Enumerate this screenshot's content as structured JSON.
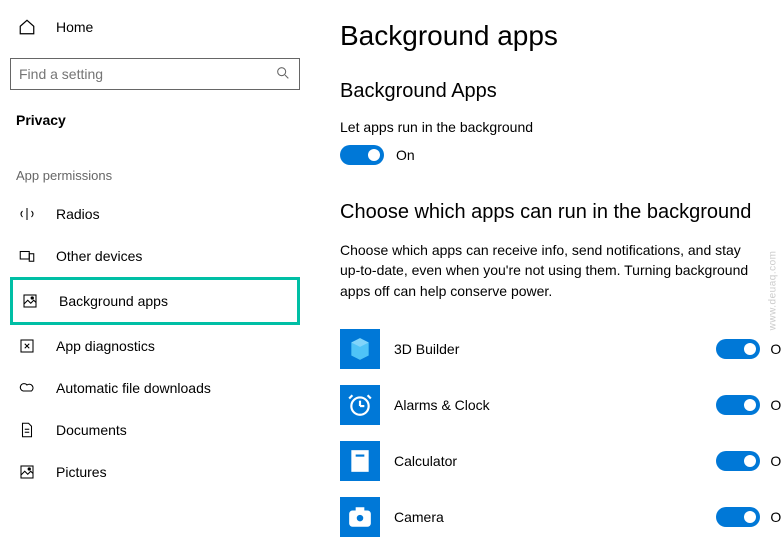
{
  "sidebar": {
    "home_label": "Home",
    "search_placeholder": "Find a setting",
    "section": "Privacy",
    "group": "App permissions",
    "items": [
      {
        "label": "Radios"
      },
      {
        "label": "Other devices"
      },
      {
        "label": "Background apps"
      },
      {
        "label": "App diagnostics"
      },
      {
        "label": "Automatic file downloads"
      },
      {
        "label": "Documents"
      },
      {
        "label": "Pictures"
      }
    ]
  },
  "main": {
    "title": "Background apps",
    "subheading1": "Background Apps",
    "master_label": "Let apps run in the background",
    "master_state": "On",
    "subheading2": "Choose which apps can run in the background",
    "description": "Choose which apps can receive info, send notifications, and stay up-to-date, even when you're not using them. Turning background apps off can help conserve power.",
    "apps": [
      {
        "name": "3D Builder",
        "state": "On"
      },
      {
        "name": "Alarms & Clock",
        "state": "On"
      },
      {
        "name": "Calculator",
        "state": "On"
      },
      {
        "name": "Camera",
        "state": "On"
      }
    ]
  },
  "watermark": "www.deuaq.com"
}
